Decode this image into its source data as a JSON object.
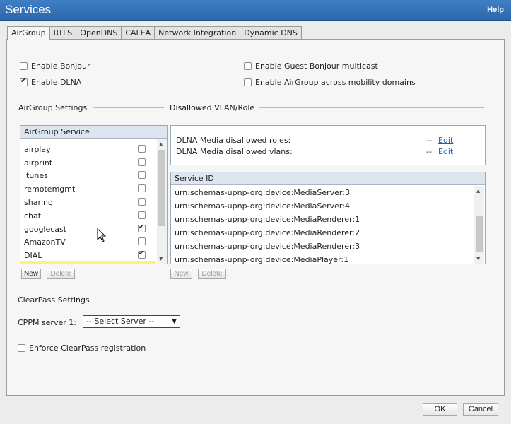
{
  "window": {
    "title": "Services",
    "help_label": "Help"
  },
  "tabs": [
    {
      "label": "AirGroup",
      "active": true
    },
    {
      "label": "RTLS"
    },
    {
      "label": "OpenDNS"
    },
    {
      "label": "CALEA"
    },
    {
      "label": "Network Integration"
    },
    {
      "label": "Dynamic DNS"
    }
  ],
  "options": {
    "enable_bonjour": {
      "label": "Enable Bonjour",
      "checked": false
    },
    "enable_dlna": {
      "label": "Enable DLNA",
      "checked": true
    },
    "enable_guest_bonjour": {
      "label": "Enable Guest Bonjour multicast",
      "checked": false
    },
    "enable_airgroup_mobility": {
      "label": "Enable AirGroup across mobility domains",
      "checked": false
    }
  },
  "airgroup_settings": {
    "heading": "AirGroup Settings",
    "list_header": "AirGroup Service",
    "services": [
      {
        "name": "airplay",
        "checked": false
      },
      {
        "name": "airprint",
        "checked": false
      },
      {
        "name": "itunes",
        "checked": false
      },
      {
        "name": "remotemgmt",
        "checked": false
      },
      {
        "name": "sharing",
        "checked": false
      },
      {
        "name": "chat",
        "checked": false
      },
      {
        "name": "googlecast",
        "checked": true
      },
      {
        "name": "AmazonTV",
        "checked": false
      },
      {
        "name": "DIAL",
        "checked": true
      }
    ],
    "new_label": "New",
    "delete_label": "Delete"
  },
  "disallowed": {
    "heading": "Disallowed VLAN/Role",
    "roles_label": "DLNA Media disallowed roles:",
    "roles_value": "--",
    "vlans_label": "DLNA Media disallowed vlans:",
    "vlans_value": "--",
    "edit_label": "Edit"
  },
  "service_ids": {
    "header": "Service ID",
    "items": [
      "urn:schemas-upnp-org:device:MediaServer:3",
      "urn:schemas-upnp-org:device:MediaServer:4",
      "urn:schemas-upnp-org:device:MediaRenderer:1",
      "urn:schemas-upnp-org:device:MediaRenderer:2",
      "urn:schemas-upnp-org:device:MediaRenderer:3",
      "urn:schemas-upnp-org:device:MediaPlayer:1"
    ],
    "new_label": "New",
    "delete_label": "Delete"
  },
  "clearpass": {
    "heading": "ClearPass Settings",
    "cppm_label": "CPPM server 1:",
    "cppm_value": "-- Select Server --",
    "enforce_label": "Enforce ClearPass registration",
    "enforce_checked": false
  },
  "footer": {
    "ok_label": "OK",
    "cancel_label": "Cancel"
  },
  "colors": {
    "titlebar": "#2f6fb6",
    "link": "#1f5fa8",
    "highlight": "#fff27a"
  }
}
